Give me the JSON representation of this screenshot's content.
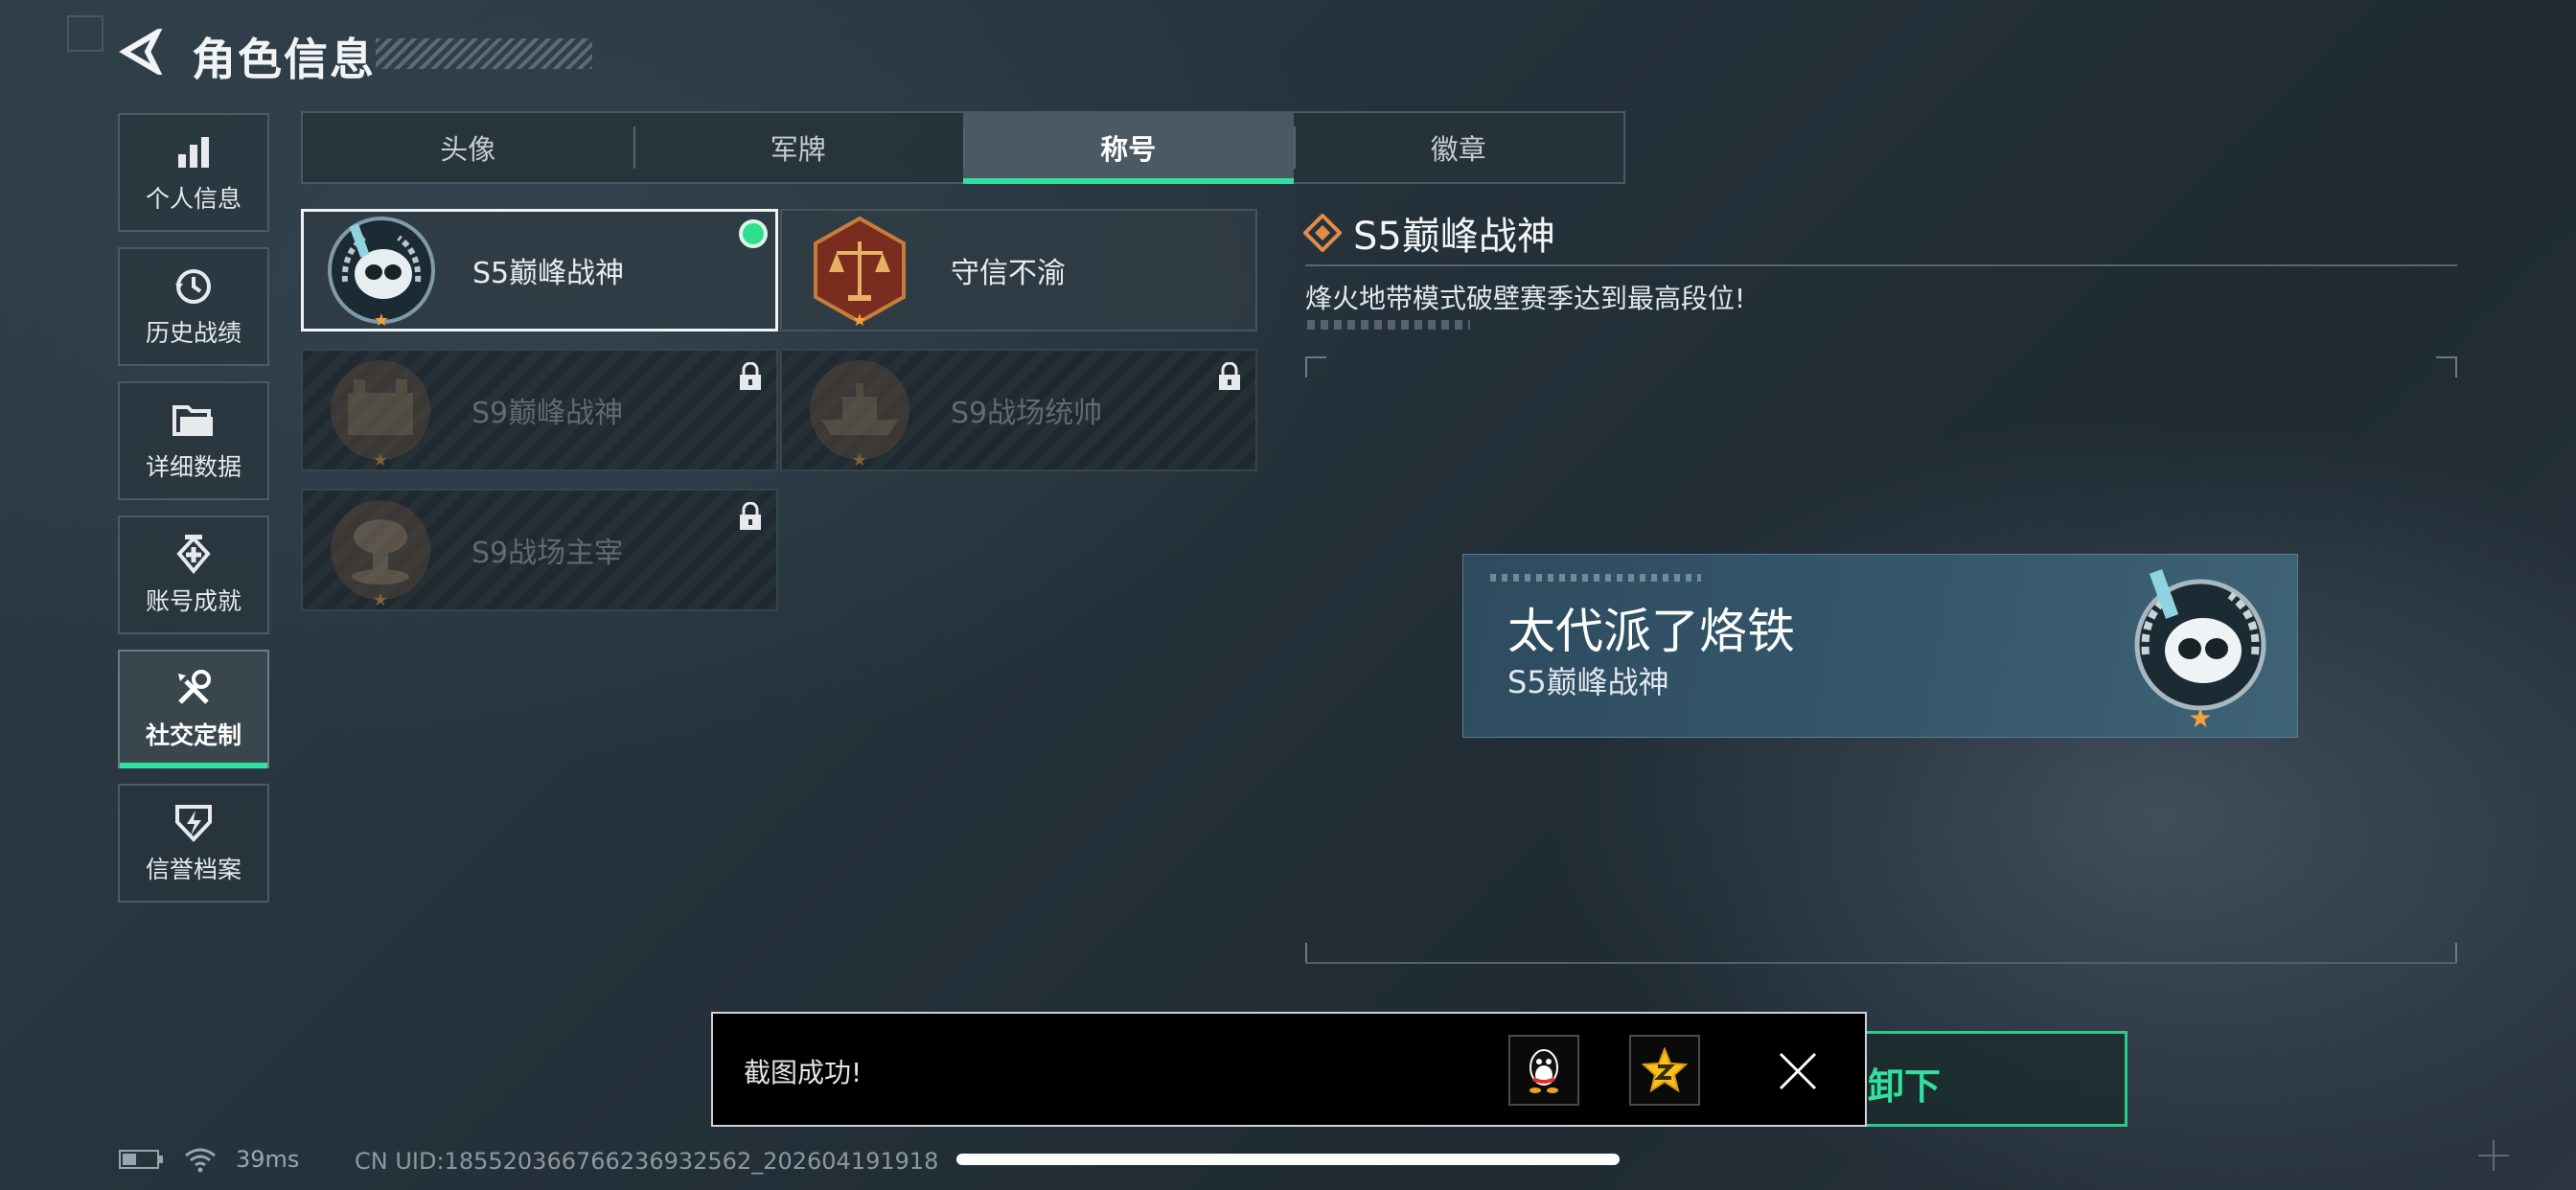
{
  "header": {
    "title": "角色信息"
  },
  "sidebar": {
    "items": [
      {
        "label": "个人信息",
        "icon": "bar-chart-icon"
      },
      {
        "label": "历史战绩",
        "icon": "history-clock-icon"
      },
      {
        "label": "详细数据",
        "icon": "folder-icon"
      },
      {
        "label": "账号成就",
        "icon": "achievement-badge-icon"
      },
      {
        "label": "社交定制",
        "icon": "wrench-screwdriver-icon",
        "active": true
      },
      {
        "label": "信誉档案",
        "icon": "shield-lightning-icon"
      }
    ]
  },
  "tabs": [
    {
      "label": "头像"
    },
    {
      "label": "军牌"
    },
    {
      "label": "称号",
      "active": true
    },
    {
      "label": "徽章"
    }
  ],
  "titles": [
    {
      "name": "S5巅峰战神",
      "selected": true,
      "equipped": true,
      "locked": false,
      "emblem": "diver-skull-emblem-icon"
    },
    {
      "name": "守信不渝",
      "selected": false,
      "locked": false,
      "emblem": "scales-emblem-icon"
    },
    {
      "name": "S9巅峰战神",
      "locked": true,
      "emblem": "fortress-emblem-icon"
    },
    {
      "name": "S9战场统帅",
      "locked": true,
      "emblem": "warship-emblem-icon"
    },
    {
      "name": "S9战场主宰",
      "locked": true,
      "emblem": "mushroom-cloud-emblem-icon"
    }
  ],
  "detail": {
    "title": "S5巅峰战神",
    "description": "烽火地带模式破壁赛季达到最高段位!"
  },
  "nameplate": {
    "player_name": "太代派了烙铁",
    "title": "S5巅峰战神"
  },
  "toast": {
    "text": "截图成功!",
    "share_targets": [
      "qq-penguin-icon",
      "qzone-star-icon"
    ]
  },
  "behind_button": {
    "label": "卸下"
  },
  "status_bar": {
    "ping": "39ms",
    "uid": "CN UID:18552036676623693256​2_202604191918"
  },
  "colors": {
    "accent": "#34e0a0",
    "equipped_dot": "#2ee08e",
    "star": "#f2a23a"
  }
}
